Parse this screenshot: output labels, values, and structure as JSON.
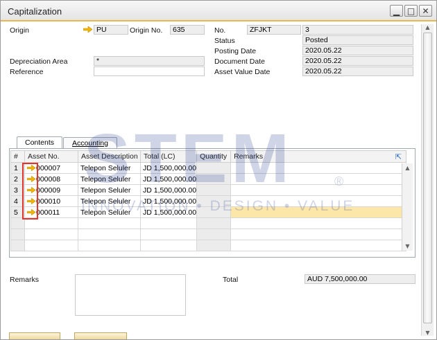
{
  "window": {
    "title": "Capitalization"
  },
  "header": {
    "origin_label": "Origin",
    "origin_value": "PU",
    "origin_no_label": "Origin No.",
    "origin_no_value": "635",
    "no_label": "No.",
    "no_series": "ZFJKT",
    "no_value": "3",
    "status_label": "Status",
    "status_value": "Posted",
    "posting_date_label": "Posting Date",
    "posting_date_value": "2020.05.22",
    "document_date_label": "Document Date",
    "document_date_value": "2020.05.22",
    "asset_value_date_label": "Asset Value Date",
    "asset_value_date_value": "2020.05.22",
    "depreciation_area_label": "Depreciation Area",
    "depreciation_area_value": "*",
    "reference_label": "Reference",
    "reference_value": ""
  },
  "tabs": [
    {
      "label": "Contents",
      "active": true
    },
    {
      "label": "Accounting",
      "active": false
    }
  ],
  "grid": {
    "columns": [
      "#",
      "Asset No.",
      "Asset Description",
      "Total (LC)",
      "Quantity",
      "Remarks"
    ],
    "rows": [
      {
        "num": "1",
        "asset_no": "000007",
        "description": "Telepon Seluler",
        "total": "JD 1,500,000.00",
        "quantity": "",
        "remarks": ""
      },
      {
        "num": "2",
        "asset_no": "000008",
        "description": "Telepon Seluler",
        "total": "JD 1,500,000.00",
        "quantity": "",
        "remarks": ""
      },
      {
        "num": "3",
        "asset_no": "000009",
        "description": "Telepon Seluler",
        "total": "JD 1,500,000.00",
        "quantity": "",
        "remarks": ""
      },
      {
        "num": "4",
        "asset_no": "000010",
        "description": "Telepon Seluler",
        "total": "JD 1,500,000.00",
        "quantity": "",
        "remarks": ""
      },
      {
        "num": "5",
        "asset_no": "000011",
        "description": "Telepon Seluler",
        "total": "JD 1,500,000.00",
        "quantity": "",
        "remarks": ""
      }
    ]
  },
  "footer": {
    "remarks_label": "Remarks",
    "total_label": "Total",
    "total_value": "AUD 7,500,000.00"
  },
  "watermark": {
    "brand": "STEM",
    "tagline": "INNOVATION • DESIGN • VALUE",
    "reg": "®"
  },
  "colors": {
    "accent": "#e8b64a",
    "highlight_row": "#fde7a8",
    "link_arrow": "#f2b705",
    "callout": "#e0332b"
  }
}
